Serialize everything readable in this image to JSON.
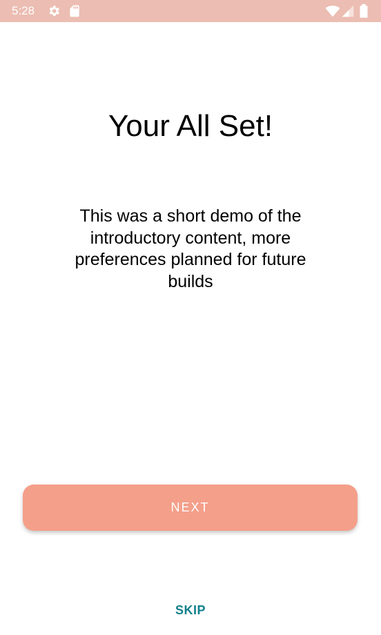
{
  "status_bar": {
    "time": "5:28",
    "background_color": "#ecbdb2",
    "icons": [
      "gear-icon",
      "sd-card-icon",
      "wifi-icon",
      "signal-icon",
      "battery-icon"
    ]
  },
  "main": {
    "title": "Your All Set!",
    "description": "This was a short demo of the introductory content, more preferences planned for future builds"
  },
  "actions": {
    "next_label": "NEXT",
    "next_color": "#f49f8a",
    "skip_label": "SKIP",
    "skip_color": "#11808b"
  }
}
